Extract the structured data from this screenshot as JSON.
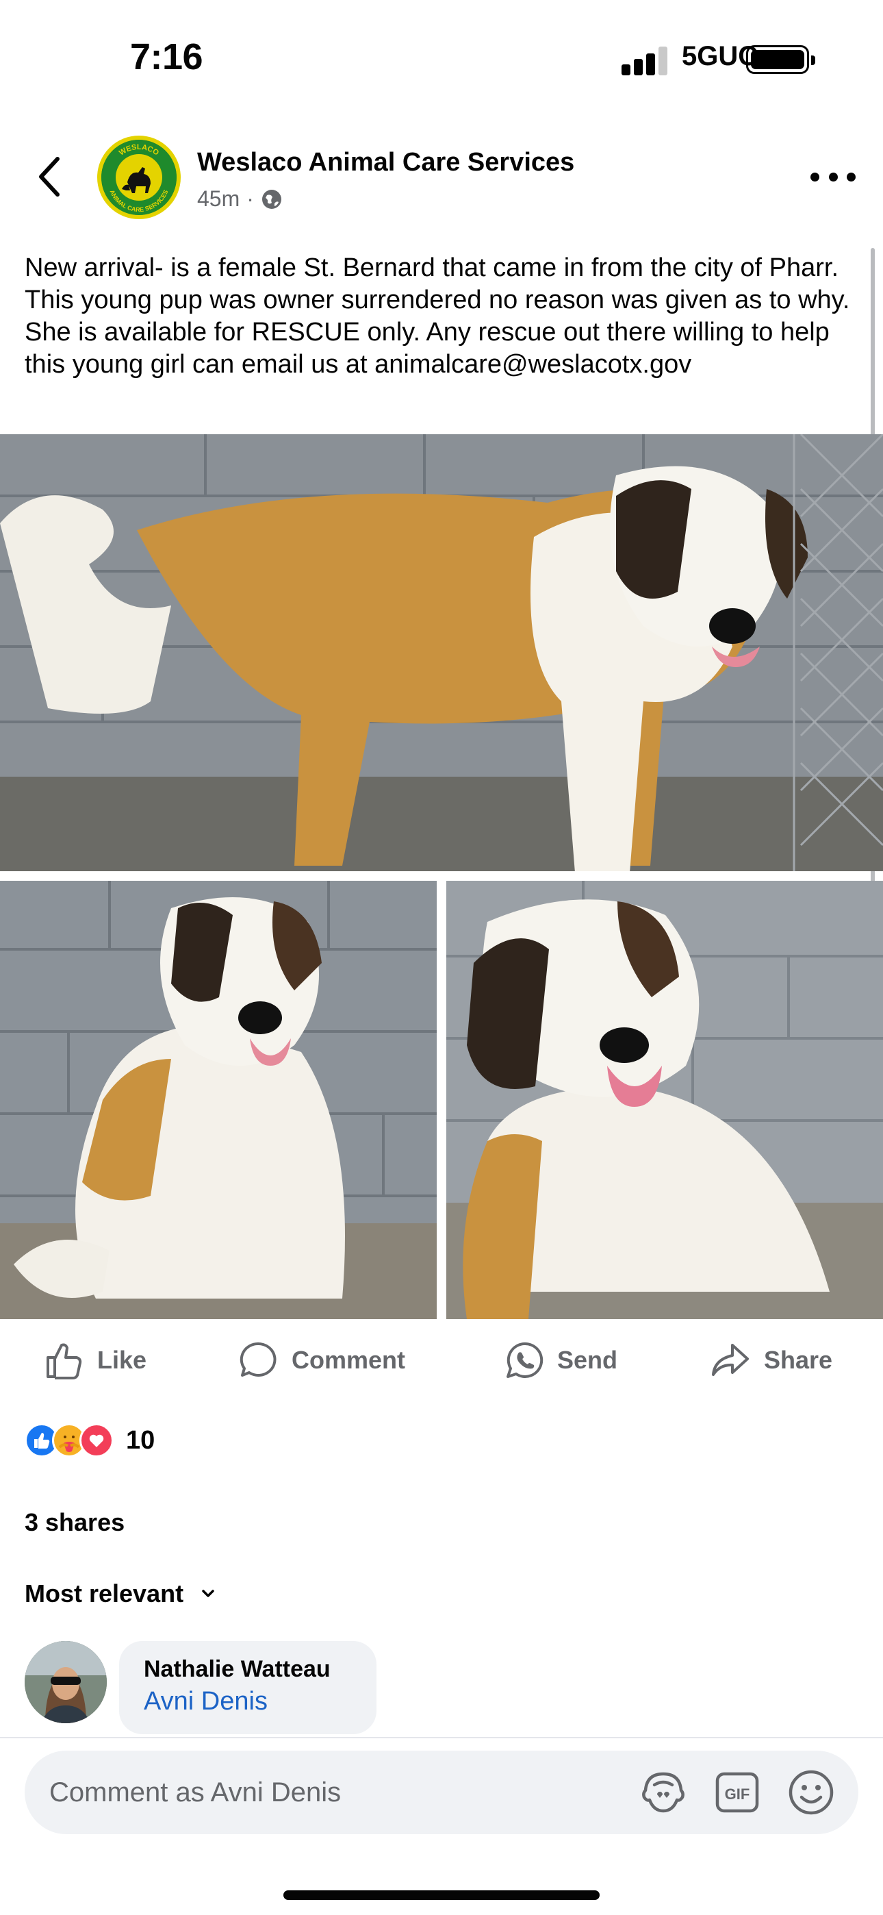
{
  "status_bar": {
    "time": "7:16",
    "network": "5GUC",
    "battery_level": 1.0
  },
  "header": {
    "page_name": "Weslaco Animal Care Services",
    "timestamp": "45m",
    "separator": "·",
    "privacy_icon": "globe-icon",
    "logo_top_text": "WESLACO",
    "logo_bottom_text": "ANIMAL CARE SERVICES"
  },
  "post": {
    "text": "New arrival- is a female St. Bernard that came in from the city of Pharr. This young pup was owner surrendered no reason was given as to why. She is available for RESCUE only. Any rescue out there willing to help this young girl can email us at animalcare@weslacotx.gov"
  },
  "actions": {
    "like": "Like",
    "comment": "Comment",
    "send": "Send",
    "share": "Share"
  },
  "reactions": {
    "icons": [
      "like-icon",
      "care-icon",
      "love-icon"
    ],
    "count": "10"
  },
  "shares": "3 shares",
  "sort": {
    "label": "Most relevant"
  },
  "comments": [
    {
      "author": "Nathalie Watteau",
      "text": "Avni Denis"
    }
  ],
  "composer": {
    "placeholder": "Comment as Avni Denis"
  },
  "colors": {
    "accent": "#1877f2",
    "mention": "#1c63c6",
    "secondary_text": "#65676b",
    "bubble": "#f0f2f5"
  }
}
